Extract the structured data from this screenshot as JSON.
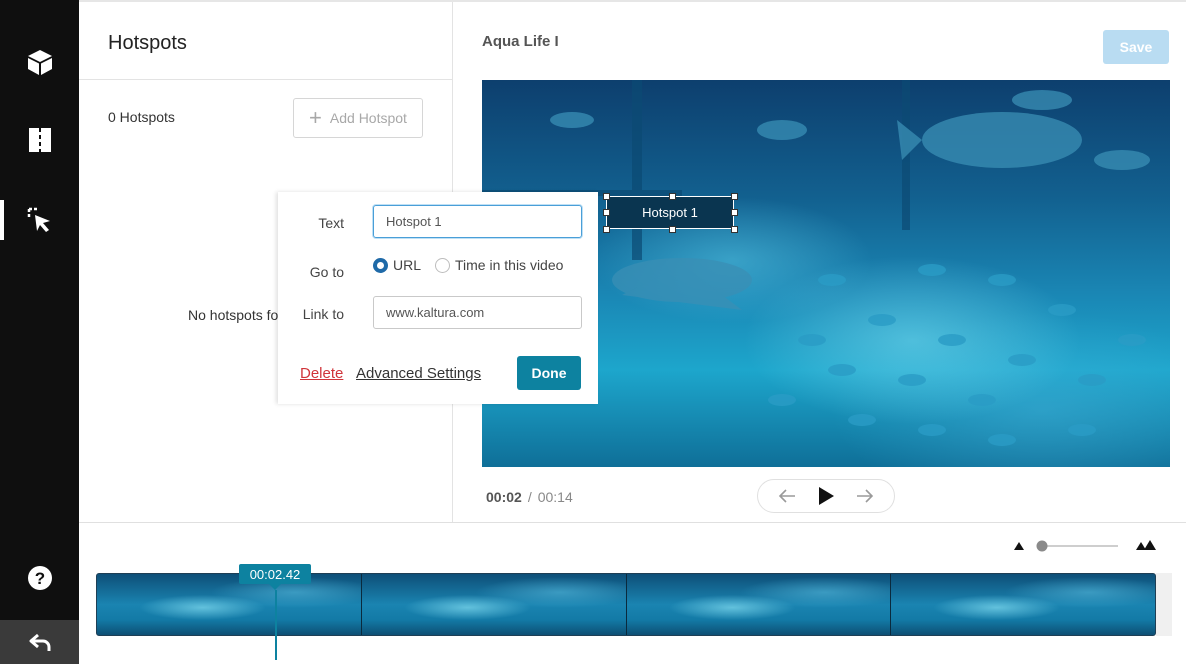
{
  "rail": {
    "items": [
      {
        "icon": "cube-icon"
      },
      {
        "icon": "film-strip-icon"
      },
      {
        "icon": "cursor-select-icon",
        "active": true
      }
    ],
    "help_icon": "help-icon",
    "back_icon": "undo-arrow-icon"
  },
  "panel": {
    "title": "Hotspots",
    "count_label": "0 Hotspots",
    "add_button": "Add Hotspot",
    "empty_message": "No hotspots fo"
  },
  "header": {
    "video_title": "Aqua Life I",
    "save_label": "Save"
  },
  "hotspot": {
    "label": "Hotspot 1"
  },
  "form": {
    "text_label": "Text",
    "text_value": "Hotspot 1",
    "goto_label": "Go to",
    "goto_options": [
      {
        "label": "URL",
        "selected": true
      },
      {
        "label": "Time in this video",
        "selected": false
      }
    ],
    "link_label": "Link to",
    "link_value": "www.kaltura.com",
    "delete_label": "Delete",
    "advanced_label": "Advanced Settings",
    "done_label": "Done"
  },
  "player": {
    "current_time": "00:02",
    "duration": "00:14",
    "separator": "/"
  },
  "timeline": {
    "cursor_time": "00:02.42",
    "thumbnail_count": 4
  },
  "colors": {
    "accent": "#0d82a0",
    "save_disabled": "#b9dcf2",
    "delete": "#d0343a",
    "radio_on": "#1f6aa8"
  }
}
